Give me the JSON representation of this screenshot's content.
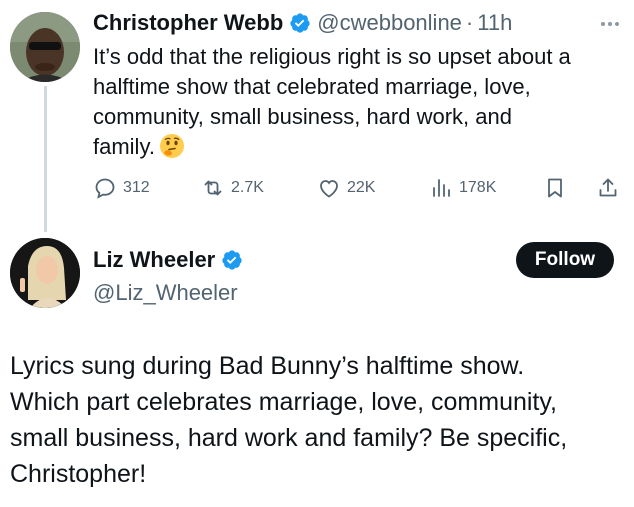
{
  "tweet1": {
    "author_name": "Christopher Webb",
    "handle": "@cwebbonline",
    "separator": "·",
    "time": "11h",
    "text_lines": [
      "It’s odd that the religious right is so upset about a",
      "halftime show that celebrated marriage, love,",
      "community, small business, hard work, and",
      "family."
    ],
    "emoji": "thinking-face-icon",
    "actions": {
      "replies": "312",
      "reposts": "2.7K",
      "likes": "22K",
      "views": "178K"
    }
  },
  "tweet2": {
    "author_name": "Liz Wheeler",
    "handle": "@Liz_Wheeler",
    "follow_label": "Follow",
    "text_lines": [
      "Lyrics sung during Bad Bunny’s halftime show.",
      "Which part celebrates marriage, love, community,",
      "small business, hard work and family? Be specific,",
      "Christopher!"
    ]
  },
  "colors": {
    "verified_blue": "#1d9bf0",
    "text": "#0f1419",
    "muted": "#536471",
    "thread_line": "#cfd9de",
    "button_bg": "#0f1419"
  }
}
